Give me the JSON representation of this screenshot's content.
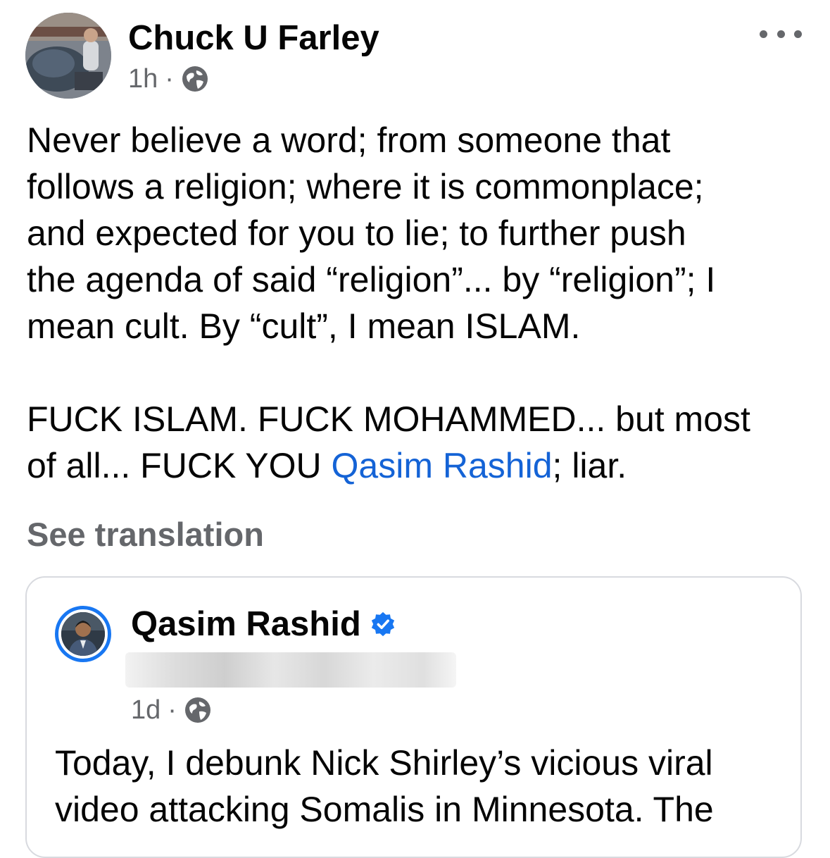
{
  "post": {
    "author_name": "Chuck U Farley",
    "time_ago": "1h",
    "meta_separator": "·",
    "audience_icon": "globe-icon",
    "more_icon": "more-options-icon",
    "body_main": "Never believe a word; from someone that\nfollows a religion; where it is commonplace;\nand expected for you to lie; to further push\nthe agenda of said “religion”... by “religion”; I\nmean cult. By “cult”, I mean ISLAM.\n\nFUCK ISLAM. FUCK MOHAMMED... but most\nof all... FUCK YOU ",
    "mention": "Qasim Rashid",
    "body_tail": "; liar.",
    "see_translation": "See translation"
  },
  "shared_post": {
    "author_name": "Qasim Rashid",
    "verified_icon": "verified-badge-icon",
    "time_ago": "1d",
    "meta_separator": "·",
    "audience_icon": "globe-icon",
    "body": "Today, I debunk Nick Shirley’s vicious viral\nvideo attacking Somalis in Minnesota. The"
  },
  "colors": {
    "link": "#1463d6",
    "secondary_text": "#65676b",
    "verified": "#1877f2",
    "card_border": "#d8dadf"
  }
}
